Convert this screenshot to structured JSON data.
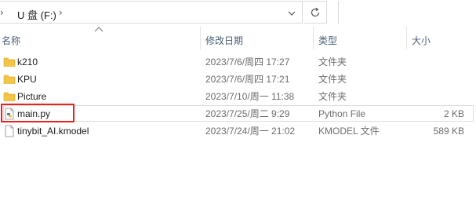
{
  "address_bar": {
    "drive_label": "U 盘 (F:)",
    "separator_glyph": "›",
    "chevron_glyph": "›"
  },
  "columns": {
    "name": "名称",
    "date": "修改日期",
    "type": "类型",
    "size": "大小",
    "sort_column": "name"
  },
  "files": [
    {
      "name": "k210",
      "date": "2023/7/6/周四 17:27",
      "type": "文件夹",
      "size": "",
      "icon": "folder-icon"
    },
    {
      "name": "KPU",
      "date": "2023/7/6/周四 17:21",
      "type": "文件夹",
      "size": "",
      "icon": "folder-icon"
    },
    {
      "name": "Picture",
      "date": "2023/7/10/周一 11:38",
      "type": "文件夹",
      "size": "",
      "icon": "folder-icon"
    },
    {
      "name": "main.py",
      "date": "2023/7/25/周二 9:29",
      "type": "Python File",
      "size": "2 KB",
      "icon": "python-file-icon"
    },
    {
      "name": "tinybit_AI.kmodel",
      "date": "2023/7/24/周一 21:02",
      "type": "KMODEL 文件",
      "size": "589 KB",
      "icon": "generic-file-icon"
    }
  ],
  "colors": {
    "folder": "#f4c547",
    "highlight_box": "#e8231c",
    "header_text": "#4c607a"
  }
}
